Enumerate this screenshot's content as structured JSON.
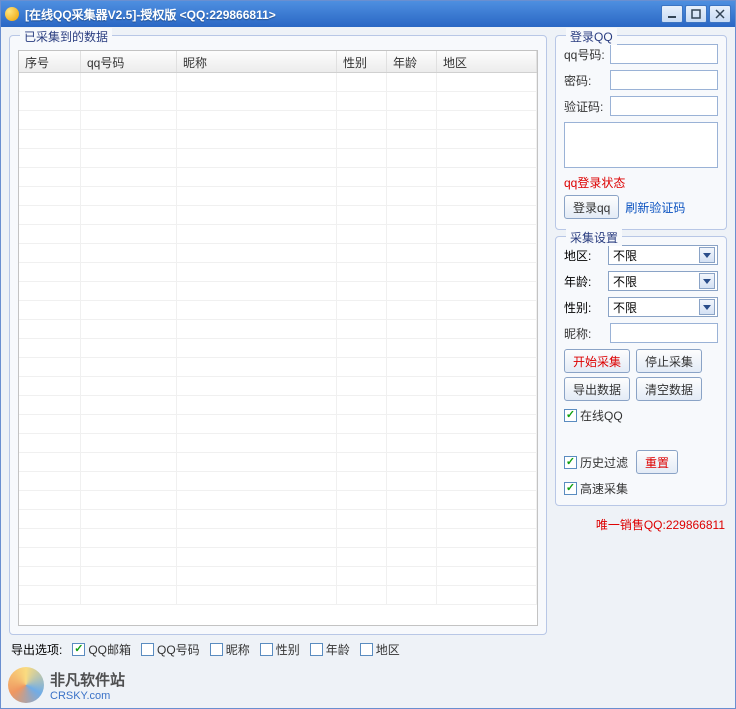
{
  "titlebar": {
    "title": "[在线QQ采集器V2.5]-授权版  <QQ:229866811>"
  },
  "data_group": {
    "legend": "已采集到的数据",
    "columns": {
      "index": "序号",
      "qq": "qq号码",
      "nick": "昵称",
      "gender": "性别",
      "age": "年龄",
      "region": "地区"
    }
  },
  "export": {
    "label": "导出选项:",
    "qq_email": "QQ邮箱",
    "qq_number": "QQ号码",
    "nick": "昵称",
    "gender": "性别",
    "age": "年龄",
    "region": "地区"
  },
  "login": {
    "legend": "登录QQ",
    "qq_label": "qq号码:",
    "pwd_label": "密码:",
    "captcha_label": "验证码:",
    "status": "qq登录状态",
    "login_btn": "登录qq",
    "refresh_captcha": "刷新验证码"
  },
  "settings": {
    "legend": "采集设置",
    "region_label": "地区:",
    "region_value": "不限",
    "age_label": "年龄:",
    "age_value": "不限",
    "gender_label": "性别:",
    "gender_value": "不限",
    "nick_label": "昵称:",
    "start_btn": "开始采集",
    "stop_btn": "停止采集",
    "export_btn": "导出数据",
    "clear_btn": "清空数据",
    "online_qq": "在线QQ",
    "history_filter": "历史过滤",
    "reset_btn": "重置",
    "fast_collect": "高速采集"
  },
  "footer": {
    "sales": "唯一销售QQ:229866811"
  },
  "watermark": {
    "name": "非凡软件站",
    "url": "CRSKY.com"
  }
}
